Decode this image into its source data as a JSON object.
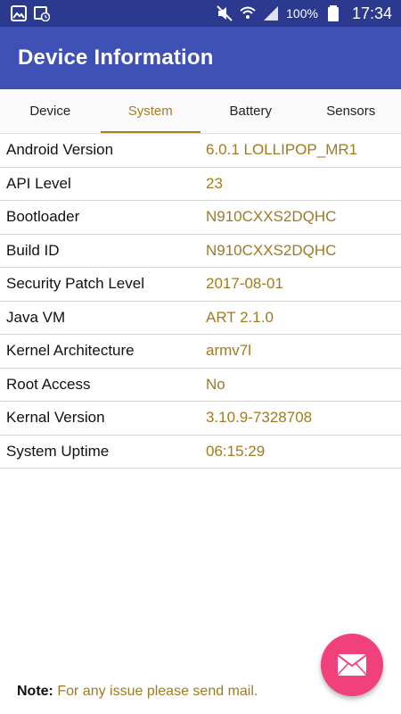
{
  "status_bar": {
    "icons_left": [
      "gallery-icon",
      "calendar-clock-icon"
    ],
    "icons_right": [
      "mute-icon",
      "wifi-icon",
      "signal-icon",
      "battery-icon"
    ],
    "battery": "100%",
    "time": "17:34"
  },
  "app_bar": {
    "title": "Device Information"
  },
  "tabs": [
    {
      "label": "Device",
      "active": false
    },
    {
      "label": "System",
      "active": true
    },
    {
      "label": "Battery",
      "active": false
    },
    {
      "label": "Sensors",
      "active": false
    }
  ],
  "system_info": [
    {
      "key": "Android Version",
      "value": "6.0.1 LOLLIPOP_MR1"
    },
    {
      "key": "API Level",
      "value": "23"
    },
    {
      "key": "Bootloader",
      "value": "N910CXXS2DQHC"
    },
    {
      "key": "Build ID",
      "value": "N910CXXS2DQHC"
    },
    {
      "key": "Security Patch Level",
      "value": "2017-08-01"
    },
    {
      "key": "Java VM",
      "value": "ART 2.1.0"
    },
    {
      "key": "Kernel Architecture",
      "value": "armv7l"
    },
    {
      "key": "Root Access",
      "value": "No"
    },
    {
      "key": "Kernal Version",
      "value": "3.10.9-7328708"
    },
    {
      "key": "System Uptime",
      "value": "06:15:29"
    }
  ],
  "fab": {
    "icon": "mail-icon"
  },
  "note": {
    "label": "Note:",
    "text": "For any issue please send mail."
  },
  "colors": {
    "status_bar": "#2b3a8f",
    "app_bar": "#3f51b5",
    "accent": "#a77c22",
    "fab": "#f0417a"
  }
}
